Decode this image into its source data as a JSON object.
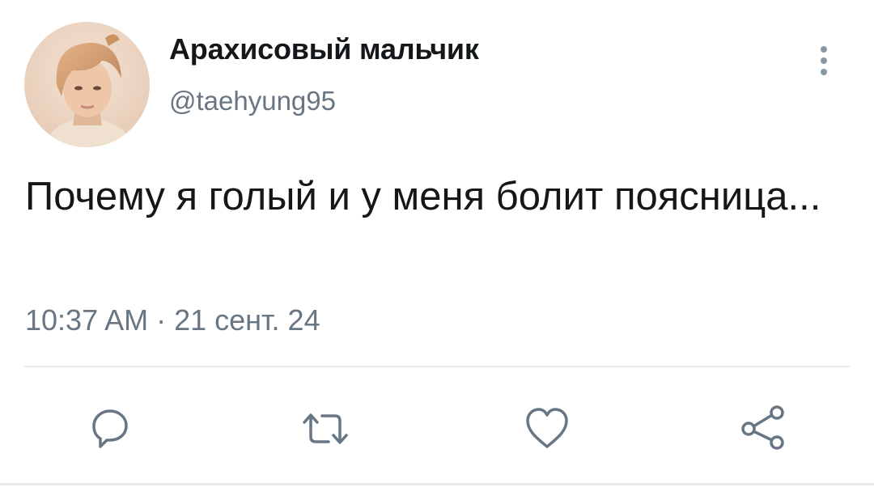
{
  "tweet": {
    "author": {
      "display_name": "Арахисовый мальчик",
      "handle": "@taehyung95"
    },
    "text": "Почему я голый и у меня болит поясница...",
    "timestamp": "10:37 AM · 21 сент. 24"
  },
  "actions": [
    {
      "name": "reply",
      "icon": "reply-icon"
    },
    {
      "name": "retweet",
      "icon": "retweet-icon"
    },
    {
      "name": "like",
      "icon": "heart-icon"
    },
    {
      "name": "share",
      "icon": "share-icon"
    }
  ],
  "colors": {
    "text_primary": "#14171a",
    "text_secondary": "#687684",
    "divider": "#e6ecf0",
    "icon": "#687684"
  }
}
